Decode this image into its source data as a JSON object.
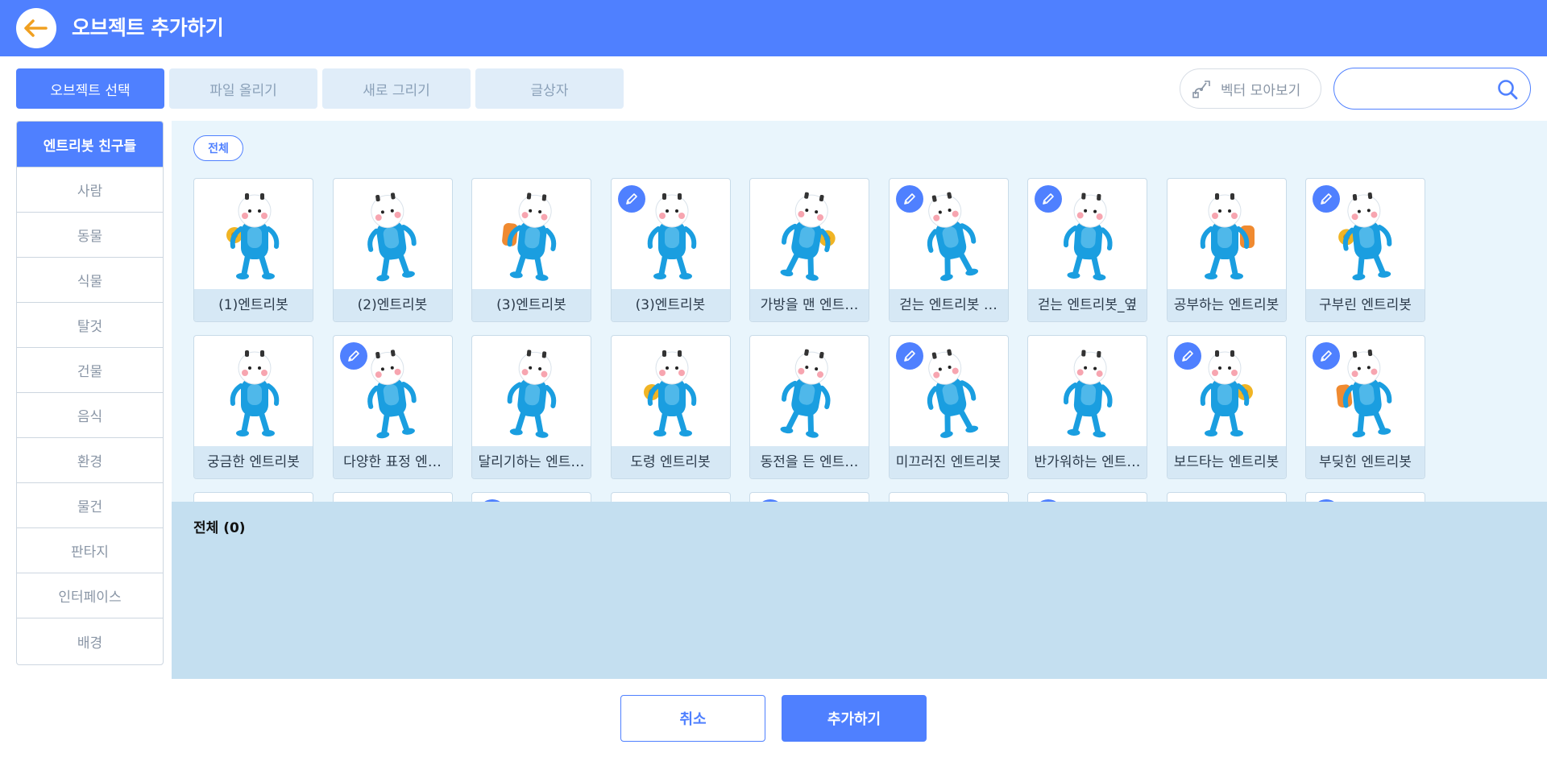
{
  "header": {
    "title": "오브젝트 추가하기",
    "back_icon": "arrow-left-icon"
  },
  "tabs": [
    {
      "label": "오브젝트 선택",
      "active": true
    },
    {
      "label": "파일 올리기",
      "active": false
    },
    {
      "label": "새로 그리기",
      "active": false
    },
    {
      "label": "글상자",
      "active": false
    }
  ],
  "vector_button": {
    "label": "벡터 모아보기",
    "icon": "vector-pen-icon"
  },
  "search": {
    "value": "",
    "placeholder": "",
    "icon": "search-icon"
  },
  "sidebar": {
    "items": [
      {
        "label": "엔트리봇 친구들",
        "active": true
      },
      {
        "label": "사람"
      },
      {
        "label": "동물"
      },
      {
        "label": "식물"
      },
      {
        "label": "탈것"
      },
      {
        "label": "건물"
      },
      {
        "label": "음식"
      },
      {
        "label": "환경"
      },
      {
        "label": "물건"
      },
      {
        "label": "판타지"
      },
      {
        "label": "인터페이스"
      },
      {
        "label": "배경"
      }
    ]
  },
  "filter": {
    "label": "전체"
  },
  "objects": [
    {
      "label": "(1)엔트리봇",
      "vector": false
    },
    {
      "label": "(2)엔트리봇",
      "vector": false
    },
    {
      "label": "(3)엔트리봇",
      "vector": false
    },
    {
      "label": "(3)엔트리봇",
      "vector": true
    },
    {
      "label": "가방을 맨 엔트…",
      "vector": false
    },
    {
      "label": "걷는 엔트리봇 …",
      "vector": true
    },
    {
      "label": "걷는 엔트리봇_옆",
      "vector": true
    },
    {
      "label": "공부하는 엔트리봇",
      "vector": false
    },
    {
      "label": "구부린 엔트리봇",
      "vector": true
    },
    {
      "label": "궁금한 엔트리봇",
      "vector": false
    },
    {
      "label": "다양한 표정 엔…",
      "vector": true
    },
    {
      "label": "달리기하는 엔트…",
      "vector": false
    },
    {
      "label": "도령 엔트리봇",
      "vector": false
    },
    {
      "label": "동전을 든 엔트…",
      "vector": false
    },
    {
      "label": "미끄러진 엔트리봇",
      "vector": true
    },
    {
      "label": "반가워하는 엔트…",
      "vector": false
    },
    {
      "label": "보드타는 엔트리봇",
      "vector": true
    },
    {
      "label": "부딪힌 엔트리봇",
      "vector": true
    },
    {
      "label": "",
      "vector": false
    },
    {
      "label": "",
      "vector": false
    },
    {
      "label": "",
      "vector": true
    },
    {
      "label": "",
      "vector": false
    },
    {
      "label": "",
      "vector": true
    },
    {
      "label": "",
      "vector": false
    },
    {
      "label": "",
      "vector": true
    },
    {
      "label": "",
      "vector": false
    },
    {
      "label": "",
      "vector": true
    }
  ],
  "selected": {
    "title": "전체 (0)"
  },
  "footer": {
    "cancel_label": "취소",
    "add_label": "추가하기"
  },
  "colors": {
    "primary": "#4f80ff",
    "panel": "#e9f5fc",
    "tray": "#c4dff0",
    "robot": "#1a9ee0",
    "gold": "#f0b424"
  }
}
